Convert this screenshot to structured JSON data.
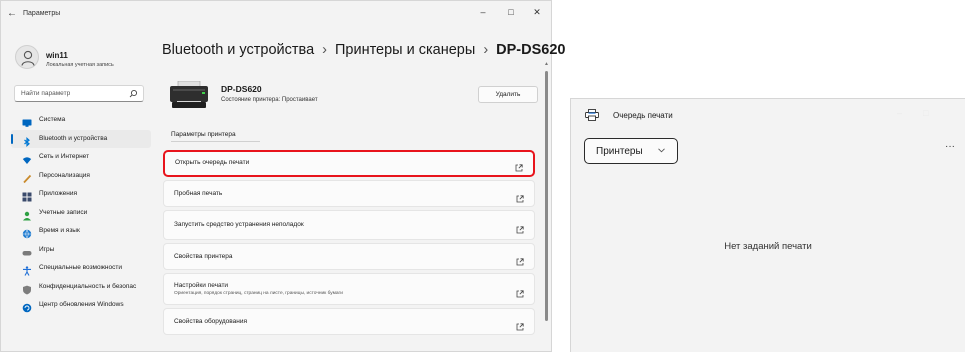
{
  "settings_window": {
    "title": "Параметры",
    "back_glyph": "←",
    "controls": {
      "minimize": "–",
      "maximize": "□",
      "close": "✕"
    },
    "user": {
      "name": "win11",
      "subtitle": "Локальная учетная запись"
    },
    "search": {
      "placeholder": "Найти параметр"
    },
    "nav": [
      {
        "label": "Система",
        "icon": "monitor-icon",
        "color": "#0067c0"
      },
      {
        "label": "Bluetooth и устройства",
        "icon": "bluetooth-icon",
        "color": "#0078d4",
        "active": true
      },
      {
        "label": "Сеть и Интернет",
        "icon": "wifi-icon",
        "color": "#0067c0"
      },
      {
        "label": "Персонализация",
        "icon": "brush-icon",
        "color": "#c98a2b"
      },
      {
        "label": "Приложения",
        "icon": "apps-icon",
        "color": "#3a4a6b"
      },
      {
        "label": "Учетные записи",
        "icon": "person-icon",
        "color": "#2ea043"
      },
      {
        "label": "Время и язык",
        "icon": "globe-icon",
        "color": "#1f7bd0"
      },
      {
        "label": "Игры",
        "icon": "gamepad-icon",
        "color": "#7a7a7a"
      },
      {
        "label": "Специальные возможности",
        "icon": "accessibility-icon",
        "color": "#1f6fd6"
      },
      {
        "label": "Конфиденциальность и безопас",
        "icon": "shield-icon",
        "color": "#7d7d7d"
      },
      {
        "label": "Центр обновления Windows",
        "icon": "update-icon",
        "color": "#0067c0"
      }
    ],
    "breadcrumb": {
      "part1": "Bluetooth и устройства",
      "part2": "Принтеры и сканеры",
      "current": "DP-DS620",
      "separator": "›"
    },
    "printer": {
      "name": "DP-DS620",
      "status": "Состояние принтера:  Простаивает",
      "delete_label": "Удалить"
    },
    "section_tab": "Параметры принтера",
    "rows": [
      {
        "label": "Открыть очередь печати",
        "highlighted": true
      },
      {
        "label": "Пробная печать"
      },
      {
        "label": "Запустить средство устранения неполадок"
      },
      {
        "label": "Свойства принтера"
      },
      {
        "label": "Настройки печати",
        "sub": "Ориентация, порядок страниц, страниц на листе, границы, источник бумаги"
      },
      {
        "label": "Свойства оборудования"
      }
    ],
    "highlight_color": "#e8141c"
  },
  "queue_window": {
    "title": "Очередь печати",
    "controls": {
      "minimize": "–",
      "maximize": "□"
    },
    "printers_button": "Принтеры",
    "more_glyph": "···",
    "empty_message": "Нет заданий печати"
  }
}
